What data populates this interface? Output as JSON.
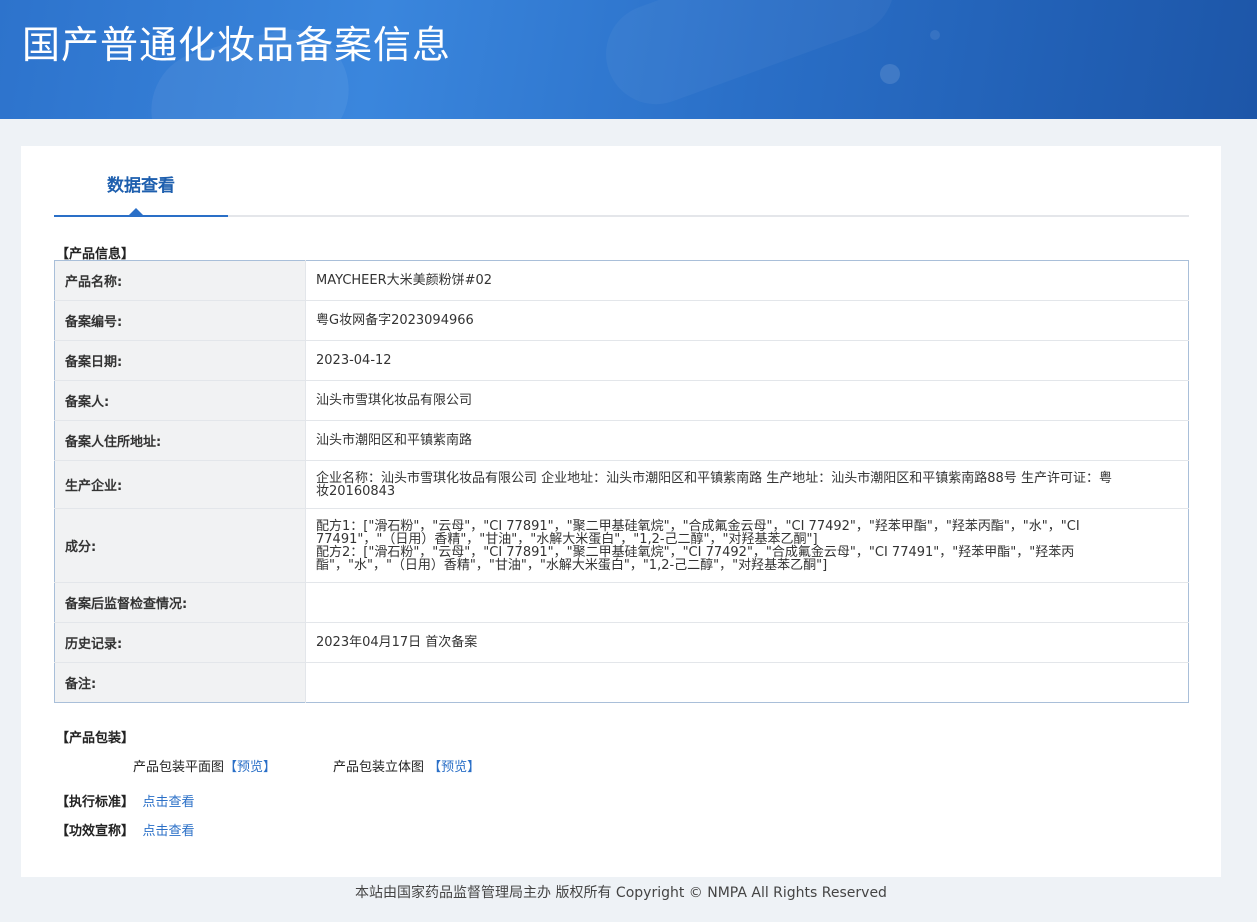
{
  "header": {
    "title": "国产普通化妆品备案信息"
  },
  "tab": {
    "label": "数据查看"
  },
  "product_section": {
    "title": "【产品信息】"
  },
  "rows": [
    {
      "key": "产品名称:",
      "value": "MAYCHEER大米美颜粉饼#02"
    },
    {
      "key": "备案编号:",
      "value": "粤G妆网备字2023094966"
    },
    {
      "key": "备案日期:",
      "value": "2023-04-12"
    },
    {
      "key": "备案人:",
      "value": "汕头市雪琪化妆品有限公司"
    },
    {
      "key": "备案人住所地址:",
      "value": "汕头市潮阳区和平镇紫南路"
    },
    {
      "key": "生产企业:",
      "value_lines": [
        "企业名称：汕头市雪琪化妆品有限公司 企业地址：汕头市潮阳区和平镇紫南路 生产地址：汕头市潮阳区和平镇紫南路88号 生产许可证：粤",
        "妆20160843"
      ]
    },
    {
      "key": "成分:",
      "value_lines": [
        "配方1：[\"滑石粉\"，\"云母\"，\"CI 77891\"，\"聚二甲基硅氧烷\"，\"合成氟金云母\"，\"CI 77492\"，\"羟苯甲酯\"，\"羟苯丙酯\"，\"水\"，\"CI",
        "77491\"，\"（日用）香精\"，\"甘油\"，\"水解大米蛋白\"，\"1,2-己二醇\"，\"对羟基苯乙酮\"]",
        "配方2：[\"滑石粉\"，\"云母\"，\"CI 77891\"，\"聚二甲基硅氧烷\"，\"CI 77492\"，\"合成氟金云母\"，\"CI 77491\"，\"羟苯甲酯\"，\"羟苯丙",
        "酯\"，\"水\"，\"（日用）香精\"，\"甘油\"，\"水解大米蛋白\"，\"1,2-己二醇\"，\"对羟基苯乙酮\"]"
      ]
    },
    {
      "key": "备案后监督检查情况:",
      "value": ""
    },
    {
      "key": "历史记录:",
      "value": "2023年04月17日 首次备案"
    },
    {
      "key": "备注:",
      "value": ""
    }
  ],
  "packaging": {
    "title": "【产品包装】",
    "flat_label": "产品包装平面图",
    "flat_link": "【预览】",
    "solid_label": "产品包装立体图",
    "solid_link": "【预览】"
  },
  "standard": {
    "title": "【执行标准】",
    "link": "点击查看"
  },
  "efficacy": {
    "title": "【功效宣称】",
    "link": "点击查看"
  },
  "footer": {
    "text": "本站由国家药品监督管理局主办 版权所有 Copyright © NMPA All Rights Reserved"
  }
}
